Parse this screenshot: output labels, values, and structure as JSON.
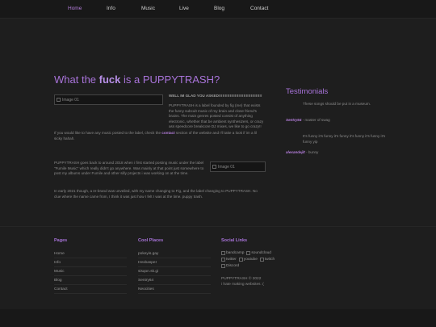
{
  "nav": {
    "items": [
      {
        "label": "Home",
        "active": true
      },
      {
        "label": "Info",
        "active": false
      },
      {
        "label": "Music",
        "active": false
      },
      {
        "label": "Live",
        "active": false
      },
      {
        "label": "Blog",
        "active": false
      },
      {
        "label": "Contact",
        "active": false
      }
    ]
  },
  "colors": {
    "accent": "#a873d9",
    "background": "#1e1e1e",
    "nav_bg": "#181818",
    "text": "#8c8c8c"
  },
  "hero": {
    "title_pre": "What the ",
    "title_bold": "fuck",
    "title_post": " is a PUPPYTRASH?"
  },
  "images": {
    "image1_alt": "Image 01",
    "image2_alt": "Image 01"
  },
  "intro": {
    "heading": "WELL IM GLAD YOU ASKED!!!!!!!!!!!!!!!!!!!!!!!!!!!!!!!!!!!",
    "para1": "PUPPYTRASH is a label founded by fig (me) that exists the funny subcult music of my brain and close friend's brains. The main genres posted consist of anything electronic, whether that be ambient synthesizers, or crazy ass speedcore breakcore DJ mixes, we like to go crazy!!",
    "para2_pre": "If you would like to have any music posted to the label, check the ",
    "para2_link": "contact",
    "para2_post": " section of the website and I'll take a look if im a lil sicky hahah."
  },
  "history": {
    "para1": "PUPPYTRASH goes back to around 2018 when i first started posting music under the label \"Fumile Music\" which really didn't go anywhere. Was mainly at that point just somewhere to post my albums under Fumile and other silly projects i was working on at the time.",
    "para2": "In early 2021 though, a re-brand was unveiled, with my name changing to Fig, and the label changing to PUPPYTRASH. No clue where the name came from, I think it was just how I felt I was at the time. puppy trash."
  },
  "testimonials": {
    "title": "Testimonials",
    "items": [
      {
        "quote": "These songs should be put in a museum.",
        "author": "Sentry64",
        "role": " - master of swag"
      },
      {
        "quote": "It's funny it's funny it's funny it's funny it's funny it's funny yip",
        "author": "alexandejlt",
        "role": " - bunny"
      }
    ]
  },
  "footer": {
    "pages_title": "Pages",
    "pages": [
      "Home",
      "Info",
      "Music",
      "Blog",
      "Contact"
    ],
    "cool_title": "Cool Places",
    "cool": [
      "pokeyis.gay",
      "Hexbasper",
      "sisqon.sk.gi",
      "Sentry64",
      "Neocities"
    ],
    "social_title": "Social Links",
    "social_row1": [
      "bandcamp",
      "soundcloud"
    ],
    "social_row2": [
      "twitter",
      "youtube",
      "twitch"
    ],
    "social_row3": [
      "Discord"
    ],
    "copyright1": "PUPPYTRASH © 2022",
    "copyright2": "i hate making websites :("
  }
}
